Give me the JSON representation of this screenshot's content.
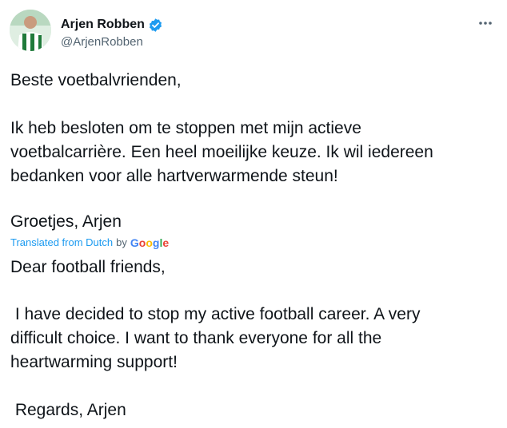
{
  "author": {
    "display_name": "Arjen Robben",
    "handle": "@ArjenRobben",
    "verified": true,
    "verified_color": "#1d9bf0"
  },
  "menu": {
    "icon": "more-horizontal-icon"
  },
  "original": {
    "line1": "Beste voetbalvrienden,",
    "line2": "Ik heb besloten om te stoppen met mijn actieve",
    "line3": "voetbalcarrière. Een heel moeilijke keuze. Ik wil iedereen",
    "line4": "bedanken voor alle hartverwarmende steun!",
    "line5": "Groetjes, Arjen"
  },
  "translation_notice": {
    "label": "Translated from Dutch",
    "by": "by",
    "provider_logo_text": "Google"
  },
  "translation": {
    "line1": "Dear football friends,",
    "line2": " I have decided to stop my active football career. A very",
    "line3": "difficult choice. I want to thank everyone for all the",
    "line4": "heartwarming support!",
    "line5": " Regards, Arjen"
  },
  "colors": {
    "text": "#0f1419",
    "secondary": "#536471",
    "link": "#1d9bf0"
  }
}
